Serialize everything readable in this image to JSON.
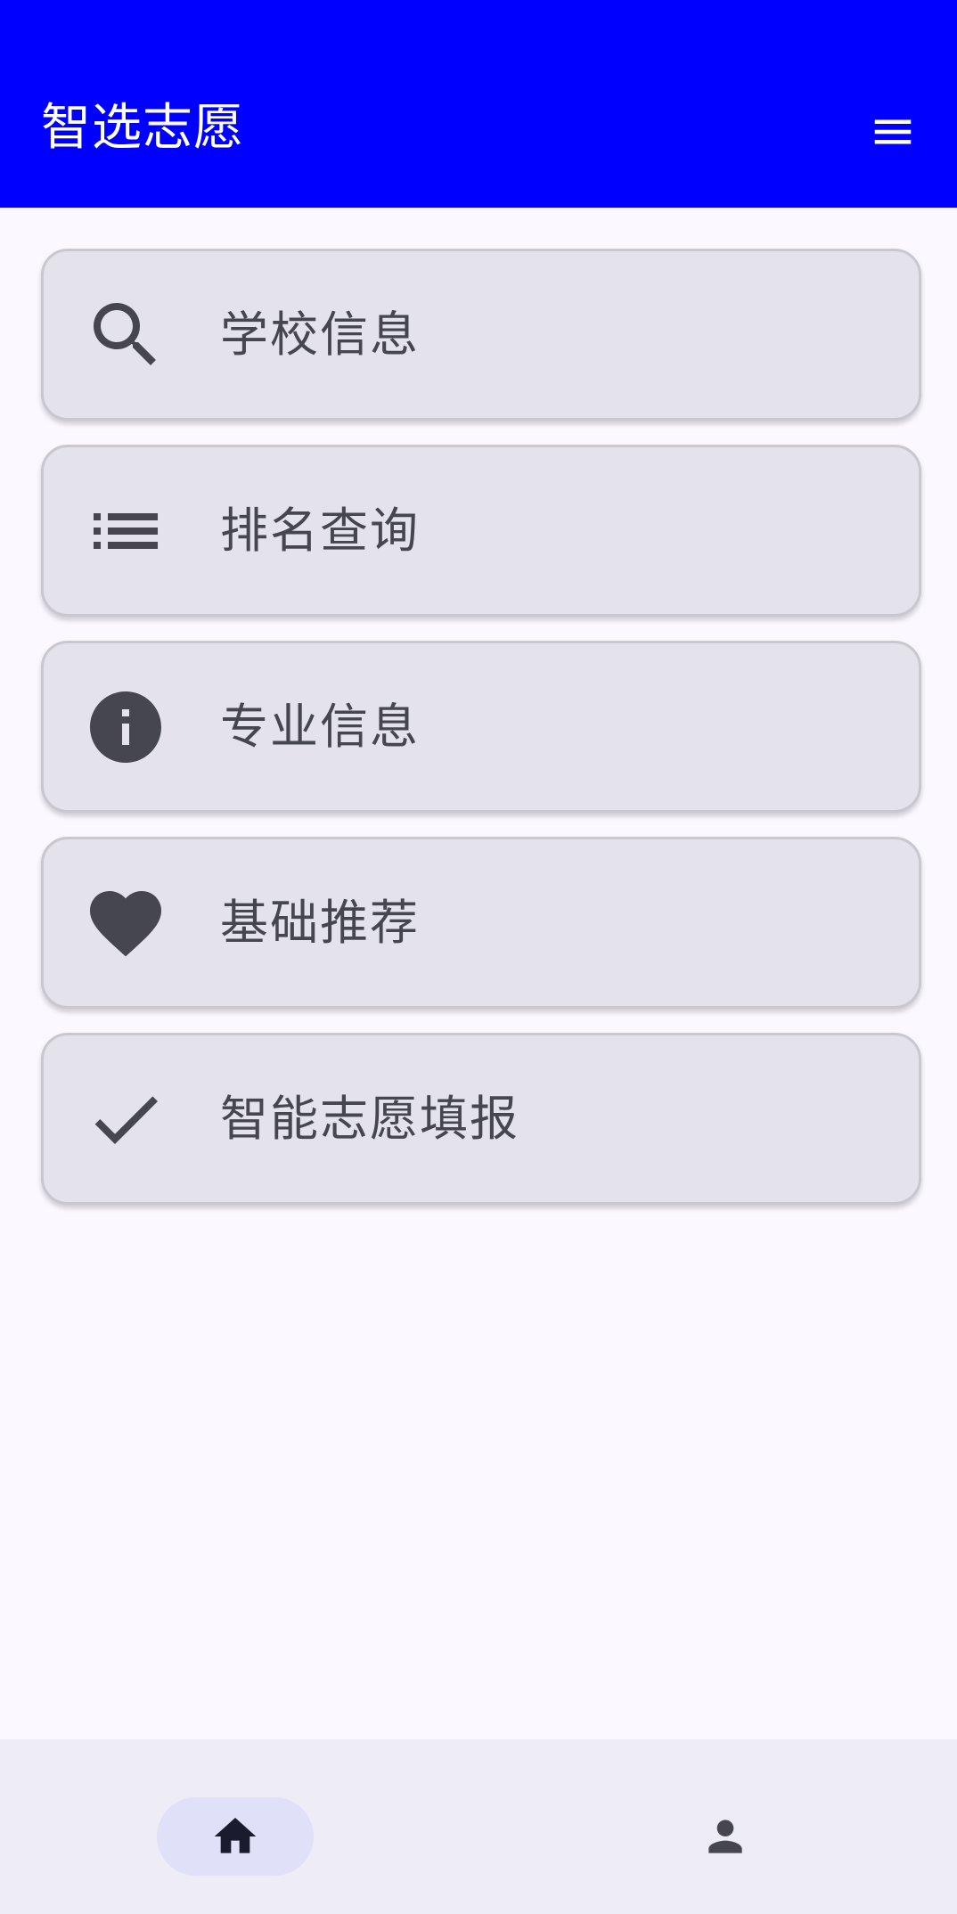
{
  "app_bar": {
    "title": "智选志愿",
    "menu_icon": "menu-icon",
    "background": "#0000ff"
  },
  "menu": {
    "items": [
      {
        "label": "学校信息",
        "icon": "search-icon"
      },
      {
        "label": "排名查询",
        "icon": "list-icon"
      },
      {
        "label": "专业信息",
        "icon": "info-icon"
      },
      {
        "label": "基础推荐",
        "icon": "heart-icon"
      },
      {
        "label": "智能志愿填报",
        "icon": "check-icon"
      }
    ]
  },
  "bottom_nav": {
    "items": [
      {
        "icon": "home-icon",
        "selected": true
      },
      {
        "icon": "person-icon",
        "selected": false
      }
    ]
  },
  "colors": {
    "primary": "#0000ff",
    "card_bg": "#e4e2ea",
    "icon": "#46464f",
    "nav_indicator": "#e0e0f8"
  }
}
